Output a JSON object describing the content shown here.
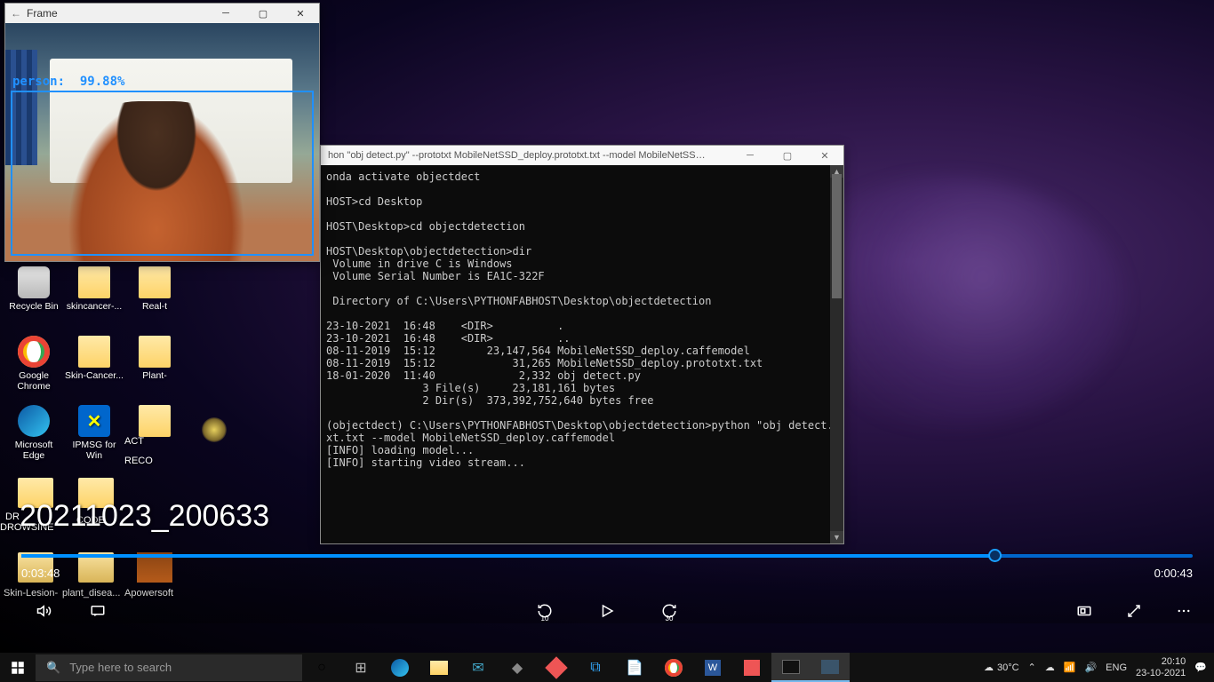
{
  "desktop_icons": [
    {
      "label": "Recycle Bin",
      "type": "bin"
    },
    {
      "label": "skincancer-...",
      "type": "folder"
    },
    {
      "label": "Real-t",
      "type": "folder"
    },
    {
      "label": "Google Chrome",
      "type": "chrome"
    },
    {
      "label": "Skin-Cancer...",
      "type": "folder"
    },
    {
      "label": "Plant-",
      "type": "folder"
    },
    {
      "label": "Microsoft Edge",
      "type": "edge"
    },
    {
      "label": "IPMSG for Win",
      "type": "ipmsg"
    },
    {
      "label": "",
      "type": "folder"
    }
  ],
  "bottom_icons": [
    {
      "label": "Skin-Lesion-"
    },
    {
      "label": "plant_disea..."
    },
    {
      "label": "Apowersoft"
    }
  ],
  "frame_window": {
    "title": "Frame",
    "detection_label": "person:",
    "detection_conf": "99.88%"
  },
  "cmd_window": {
    "title": "hon  \"obj detect.py\" --prototxt MobileNetSSD_deploy.prototxt.txt --model MobileNetSSD_depl...",
    "lines": [
      "onda activate objectdect",
      "",
      "HOST>cd Desktop",
      "",
      "HOST\\Desktop>cd objectdetection",
      "",
      "HOST\\Desktop\\objectdetection>dir",
      " Volume in drive C is Windows",
      " Volume Serial Number is EA1C-322F",
      "",
      " Directory of C:\\Users\\PYTHONFABHOST\\Desktop\\objectdetection",
      "",
      "23-10-2021  16:48    <DIR>          .",
      "23-10-2021  16:48    <DIR>          ..",
      "08-11-2019  15:12        23,147,564 MobileNetSSD_deploy.caffemodel",
      "08-11-2019  15:12            31,265 MobileNetSSD_deploy.prototxt.txt",
      "18-01-2020  11:40             2,332 obj detect.py",
      "               3 File(s)     23,181,161 bytes",
      "               2 Dir(s)  373,392,752,640 bytes free",
      "",
      "(objectdect) C:\\Users\\PYTHONFABHOST\\Desktop\\objectdetection>python \"obj detect.py\" --prototxt MobileNetSSD_deploy.protot",
      "xt.txt --model MobileNetSSD_deploy.caffemodel",
      "[INFO] loading model...",
      "[INFO] starting video stream..."
    ]
  },
  "overlay": {
    "filename": "20211023_200633",
    "left1": "ACT",
    "left2": "RECO",
    "dr": "DR",
    "drowsine": "DROWSINE",
    "code": "CODE"
  },
  "player": {
    "time_elapsed": "0:03:48",
    "time_remaining": "0:00:43",
    "skip_back": "10",
    "skip_fwd": "30"
  },
  "taskbar": {
    "search_placeholder": "Type here to search",
    "weather_temp": "30°C",
    "lang": "ENG",
    "time": "20:10",
    "date": "23-10-2021"
  }
}
